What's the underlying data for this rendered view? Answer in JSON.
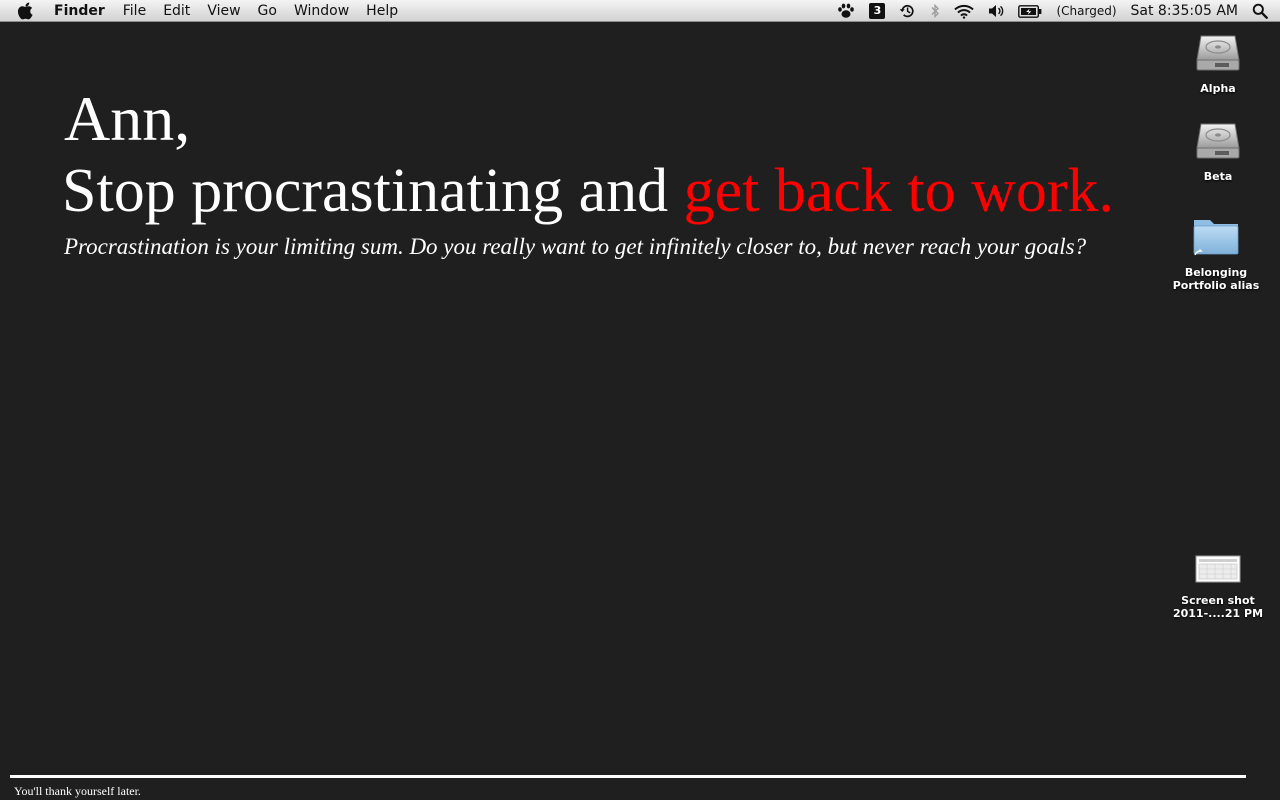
{
  "menubar": {
    "app_name": "Finder",
    "menus": [
      "File",
      "Edit",
      "View",
      "Go",
      "Window",
      "Help"
    ],
    "status_icons": [
      "paw-icon",
      "calendar-icon",
      "time-machine-icon",
      "bluetooth-icon",
      "wifi-icon",
      "volume-icon",
      "battery-icon",
      "spotlight-icon"
    ],
    "calendar_day": "3",
    "battery_status": "(Charged)",
    "clock": "Sat 8:35:05 AM"
  },
  "wallpaper": {
    "greeting": "Ann,",
    "headline_main": "Stop procrastinating and ",
    "headline_accent": "get back to work.",
    "subline": "Procrastination is your limiting sum. Do you really want to get infinitely closer to, but never reach your goals?",
    "footer": "You'll thank yourself later.",
    "colors": {
      "background": "#1f1f1f",
      "text": "#ffffff",
      "accent": "#ff0000"
    }
  },
  "desktop_icons": [
    {
      "label": "Alpha",
      "icon": "hard-drive-icon"
    },
    {
      "label": "Beta",
      "icon": "hard-drive-icon"
    },
    {
      "label_line1": "Belonging",
      "label_line2": "Portfolio alias",
      "icon": "folder-alias-icon"
    },
    {
      "label_line1": "Screen shot",
      "label_line2": "2011-....21 PM",
      "icon": "screenshot-file-icon"
    }
  ]
}
